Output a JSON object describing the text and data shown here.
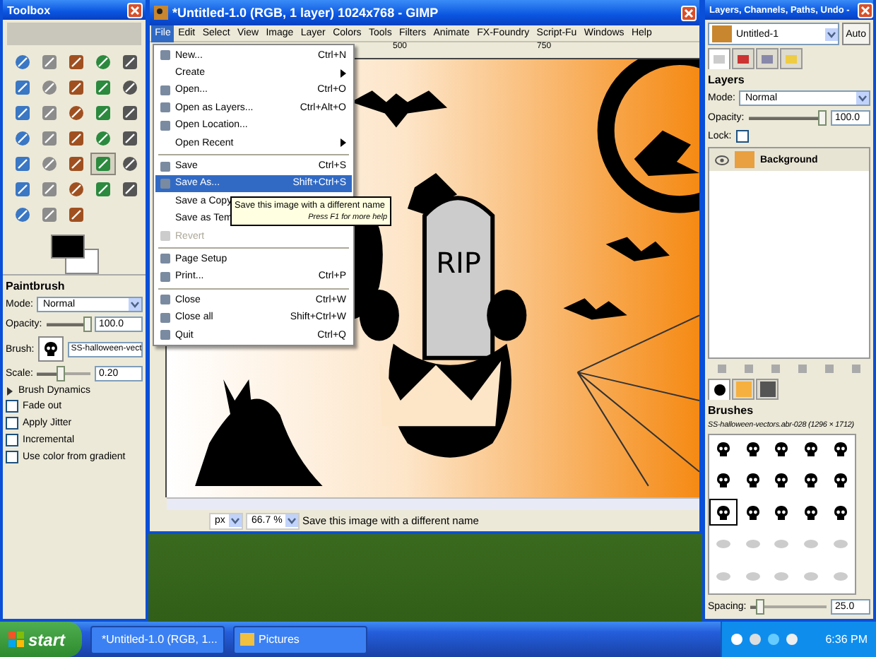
{
  "toolbox": {
    "title": "Toolbox",
    "tools": [
      {
        "selected": false
      },
      {
        "selected": false
      },
      {
        "selected": false
      },
      {
        "selected": false
      },
      {
        "selected": false
      },
      {
        "selected": false
      },
      {
        "selected": false
      },
      {
        "selected": false
      },
      {
        "selected": false
      },
      {
        "selected": false
      },
      {
        "selected": false
      },
      {
        "selected": false
      },
      {
        "selected": false
      },
      {
        "selected": false
      },
      {
        "selected": false
      },
      {
        "selected": false
      },
      {
        "selected": false
      },
      {
        "selected": false
      },
      {
        "selected": false
      },
      {
        "selected": false
      },
      {
        "selected": false
      },
      {
        "selected": false
      },
      {
        "selected": false
      },
      {
        "selected": true
      },
      {
        "selected": false
      },
      {
        "selected": false
      },
      {
        "selected": false
      },
      {
        "selected": false
      },
      {
        "selected": false
      },
      {
        "selected": false
      },
      {
        "selected": false
      },
      {
        "selected": false
      },
      {
        "selected": false
      }
    ],
    "options": {
      "title": "Paintbrush",
      "mode_label": "Mode:",
      "mode": "Normal",
      "opacity_label": "Opacity:",
      "opacity": {
        "level": 0.95,
        "value": "100.0"
      },
      "brush_label": "Brush:",
      "brush": "SS-halloween-vect",
      "scale_label": "Scale:",
      "scale": {
        "level": 0.45,
        "value": "0.20"
      },
      "dynamics": {
        "label": "Brush Dynamics",
        "expanded": false
      },
      "checkboxes": [
        {
          "label": "Fade out",
          "checked": false
        },
        {
          "label": "Apply Jitter",
          "checked": false
        },
        {
          "label": "Incremental",
          "checked": false
        },
        {
          "label": "Use color from gradient",
          "checked": false
        }
      ]
    }
  },
  "image_window": {
    "title": "*Untitled-1.0 (RGB, 1 layer) 1024x768 - GIMP",
    "menu": [
      {
        "label": "File",
        "selected": true
      },
      {
        "label": "Edit",
        "selected": false
      },
      {
        "label": "Select",
        "selected": false
      },
      {
        "label": "View",
        "selected": false
      },
      {
        "label": "Image",
        "selected": false
      },
      {
        "label": "Layer",
        "selected": false
      },
      {
        "label": "Colors",
        "selected": false
      },
      {
        "label": "Tools",
        "selected": false
      },
      {
        "label": "Filters",
        "selected": false
      },
      {
        "label": "Animate",
        "selected": false
      },
      {
        "label": "FX-Foundry",
        "selected": false
      },
      {
        "label": "Script-Fu",
        "selected": false
      },
      {
        "label": "Windows",
        "selected": false
      },
      {
        "label": "Help",
        "selected": false
      }
    ],
    "ruler_labels": [
      "500",
      "750"
    ],
    "canvas_text": "RIP",
    "file_menu": [
      {
        "kind": "item",
        "label": "New...",
        "shortcut": "Ctrl+N",
        "icon": true,
        "submenu": false,
        "selected": false,
        "disabled": false
      },
      {
        "kind": "item",
        "label": "Create",
        "icon": false,
        "submenu": true,
        "selected": false,
        "disabled": false
      },
      {
        "kind": "item",
        "label": "Open...",
        "shortcut": "Ctrl+O",
        "icon": true,
        "submenu": false,
        "selected": false,
        "disabled": false
      },
      {
        "kind": "item",
        "label": "Open as Layers...",
        "shortcut": "Ctrl+Alt+O",
        "icon": true,
        "submenu": false,
        "selected": false,
        "disabled": false
      },
      {
        "kind": "item",
        "label": "Open Location...",
        "icon": true,
        "submenu": false,
        "selected": false,
        "disabled": false
      },
      {
        "kind": "item",
        "label": "Open Recent",
        "icon": false,
        "submenu": true,
        "selected": false,
        "disabled": false
      },
      {
        "kind": "separator"
      },
      {
        "kind": "item",
        "label": "Save",
        "shortcut": "Ctrl+S",
        "icon": true,
        "submenu": false,
        "selected": false,
        "disabled": false
      },
      {
        "kind": "item",
        "label": "Save As...",
        "shortcut": "Shift+Ctrl+S",
        "icon": true,
        "submenu": false,
        "selected": true,
        "disabled": false
      },
      {
        "kind": "item",
        "label": "Save a Copy",
        "icon": false,
        "selected": false,
        "disabled": false
      },
      {
        "kind": "item",
        "label": "Save as Tem",
        "icon": false,
        "selected": false,
        "disabled": false
      },
      {
        "kind": "item",
        "label": "Revert",
        "icon": true,
        "submenu": false,
        "selected": false,
        "disabled": true
      },
      {
        "kind": "separator"
      },
      {
        "kind": "item",
        "label": "Page Setup",
        "icon": true,
        "submenu": false,
        "selected": false,
        "disabled": false
      },
      {
        "kind": "item",
        "label": "Print...",
        "shortcut": "Ctrl+P",
        "icon": true,
        "submenu": false,
        "selected": false,
        "disabled": false
      },
      {
        "kind": "separator"
      },
      {
        "kind": "item",
        "label": "Close",
        "shortcut": "Ctrl+W",
        "icon": true,
        "submenu": false,
        "selected": false,
        "disabled": false
      },
      {
        "kind": "item",
        "label": "Close all",
        "shortcut": "Shift+Ctrl+W",
        "icon": true,
        "submenu": false,
        "selected": false,
        "disabled": false
      },
      {
        "kind": "item",
        "label": "Quit",
        "shortcut": "Ctrl+Q",
        "icon": true,
        "submenu": false,
        "selected": false,
        "disabled": false
      }
    ],
    "tooltip": {
      "text": "Save this image with a different name",
      "hint": "Press F1 for more help"
    },
    "status": {
      "unit": "px",
      "zoom": "66.7 %",
      "message": "Save this image with a different name"
    }
  },
  "dock": {
    "title": "Layers, Channels, Paths, Undo -",
    "image": "Untitled-1",
    "auto": "Auto",
    "tabs": [
      {
        "selected": true
      },
      {
        "selected": false
      },
      {
        "selected": false
      },
      {
        "selected": false
      }
    ],
    "layers_title": "Layers",
    "mode_label": "Mode:",
    "mode": "Normal",
    "opacity_label": "Opacity:",
    "opacity": {
      "level": 0.95,
      "value": "100.0"
    },
    "lock_label": "Lock:",
    "lock_checked": false,
    "layers": [
      {
        "name": "Background",
        "visible": true,
        "selected": false
      }
    ],
    "resource_tabs": [
      {
        "selected": true
      },
      {
        "selected": false
      },
      {
        "selected": false
      }
    ],
    "brushes_title": "Brushes",
    "brush_name": "SS-halloween-vectors.abr-028 (1296 × 1712)",
    "brushes": [
      {
        "selected": false
      },
      {
        "selected": false
      },
      {
        "selected": false
      },
      {
        "selected": false
      },
      {
        "selected": false
      },
      {
        "selected": false
      },
      {
        "selected": false
      },
      {
        "selected": false
      },
      {
        "selected": false
      },
      {
        "selected": false
      },
      {
        "selected": true
      },
      {
        "selected": false
      },
      {
        "selected": false
      },
      {
        "selected": false
      },
      {
        "selected": false
      },
      {
        "selected": false
      },
      {
        "selected": false
      },
      {
        "selected": false
      },
      {
        "selected": false
      },
      {
        "selected": false
      },
      {
        "selected": false
      },
      {
        "selected": false
      },
      {
        "selected": false
      },
      {
        "selected": false
      },
      {
        "selected": false
      }
    ],
    "spacing_label": "Spacing:",
    "spacing": {
      "level": 0.12,
      "value": "25.0"
    }
  },
  "taskbar": {
    "start": "start",
    "tasks": [
      {
        "label": "*Untitled-1.0 (RGB, 1...",
        "selected": false
      },
      {
        "label": "Pictures",
        "selected": false
      }
    ],
    "clock": "6:36 PM"
  }
}
